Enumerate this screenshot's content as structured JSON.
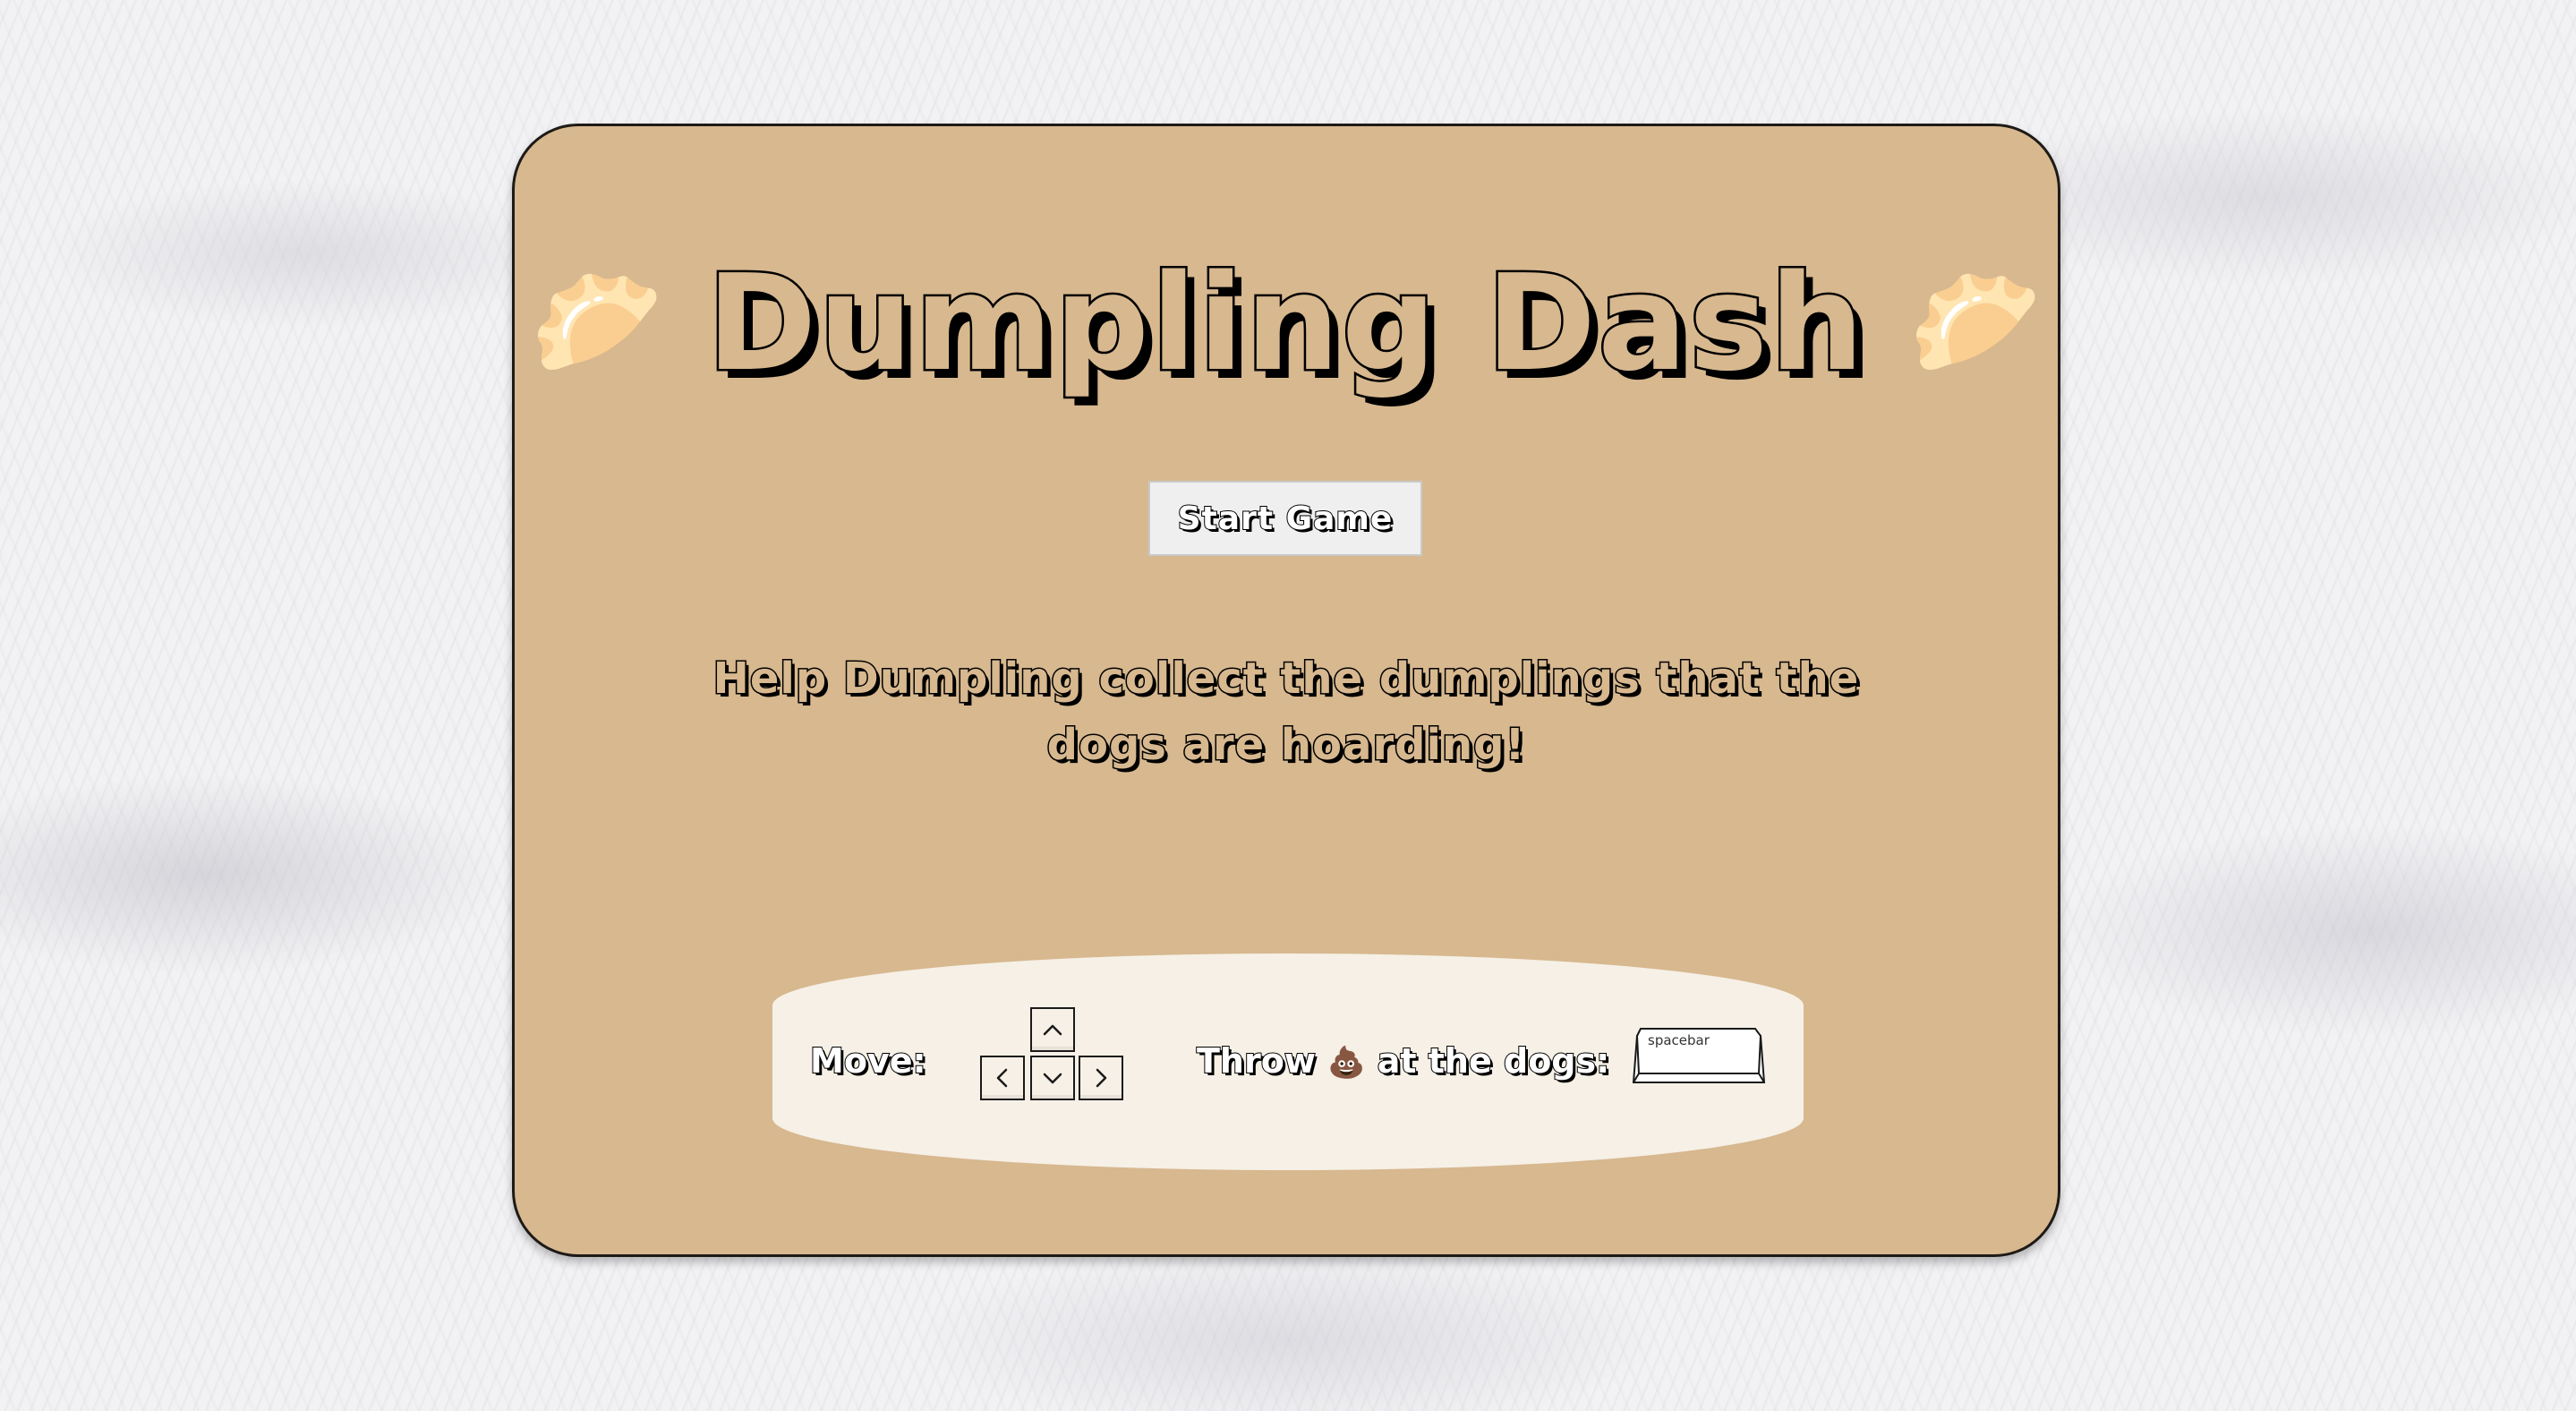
{
  "game": {
    "title": "Dumpling Dash",
    "title_emoji_left": "🥟",
    "title_emoji_right": "🥟",
    "start_button_label": "Start Game",
    "tagline": "Help Dumpling collect the dumplings that the dogs are hoarding!"
  },
  "controls": {
    "move_label": "Move:",
    "throw_label_prefix": "Throw ",
    "throw_emoji": "💩",
    "throw_label_suffix": " at the dogs:",
    "spacebar_label": "spacebar",
    "arrow_keys": [
      "up",
      "left",
      "down",
      "right"
    ]
  },
  "colors": {
    "card_background": "#d7b88f",
    "controls_background": "#f6f0e6",
    "button_background": "#efefef",
    "outline": "#000000"
  }
}
